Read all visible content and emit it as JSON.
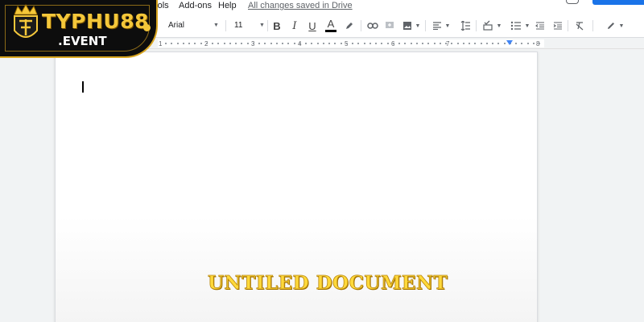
{
  "menu": {
    "items": [
      {
        "label": "Tools"
      },
      {
        "label": "Add-ons"
      },
      {
        "label": "Help"
      }
    ],
    "save_status": "All changes saved in Drive"
  },
  "toolbar": {
    "font_family": "Arial",
    "font_size": "11",
    "bold_label": "B",
    "italic_label": "I",
    "underline_label": "U",
    "text_color_label": "A",
    "accent_color": "#1a73e8"
  },
  "ruler": {
    "labels": [
      "1",
      "2",
      "3",
      "4",
      "5",
      "6",
      "7",
      "8"
    ]
  },
  "logo": {
    "text": "TYPHU88",
    "subtext": ".EVENT"
  },
  "overlay": {
    "title": "UNTILED DOCUMENT"
  }
}
